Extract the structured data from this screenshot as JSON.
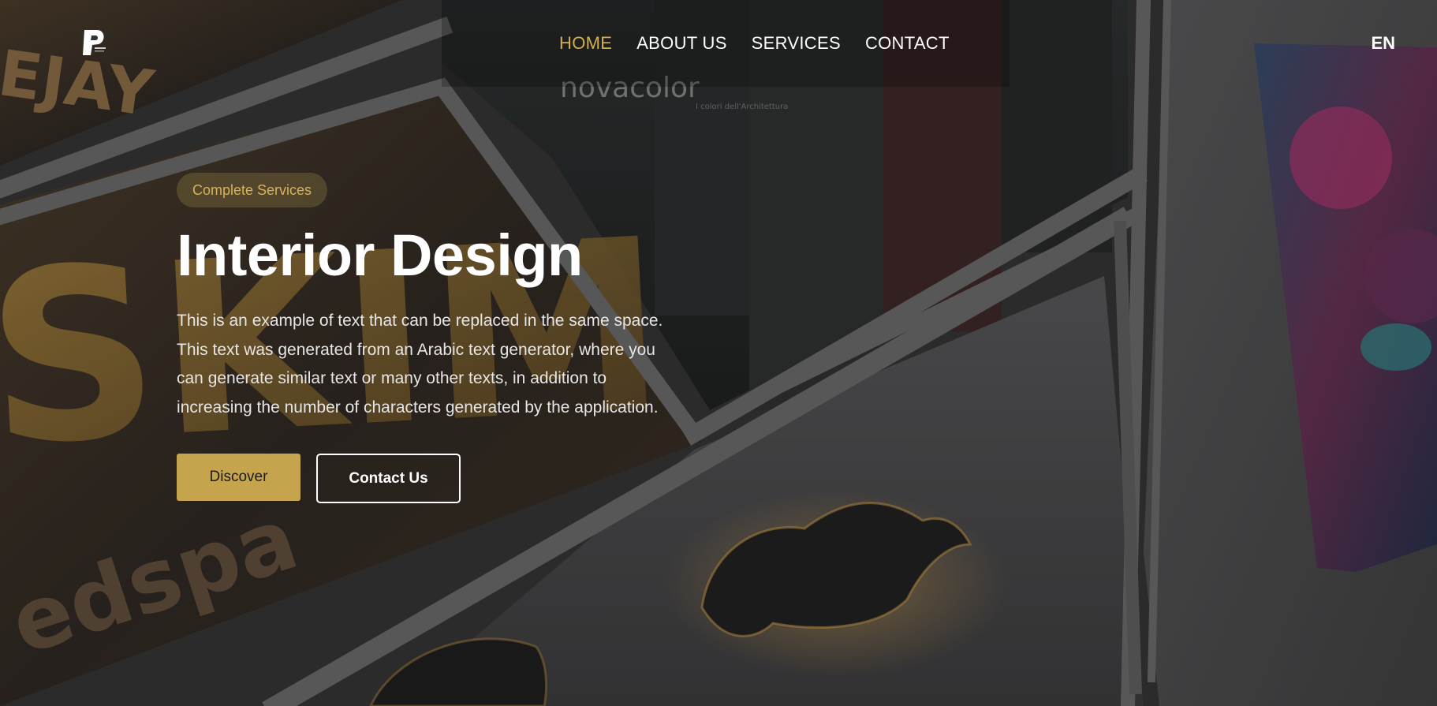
{
  "header": {
    "logo_icon": "p-letter-logo-icon",
    "nav": [
      {
        "label": "HOME",
        "active": true
      },
      {
        "label": "ABOUT US",
        "active": false
      },
      {
        "label": "SERVICES",
        "active": false
      },
      {
        "label": "CONTACT",
        "active": false
      }
    ],
    "language": "EN"
  },
  "hero": {
    "badge": "Complete Services",
    "title": "Interior Design",
    "description": "This is an example of text that can be replaced in the same space. This text was generated from an Arabic text generator, where you can generate similar text or many other texts, in addition to increasing the number of characters generated by the application.",
    "primary_button": "Discover",
    "secondary_button": "Contact Us"
  },
  "colors": {
    "accent": "#d3ad4e",
    "button_primary": "#c6a44d",
    "badge_text": "#d8b15a"
  },
  "background": {
    "signage_text": "novacolor",
    "signage_subtext": "I colori dell'Architettura",
    "sign_letters": "SKIM",
    "sign_text_lower": "edspa",
    "sign_top_text": "EJAY"
  }
}
